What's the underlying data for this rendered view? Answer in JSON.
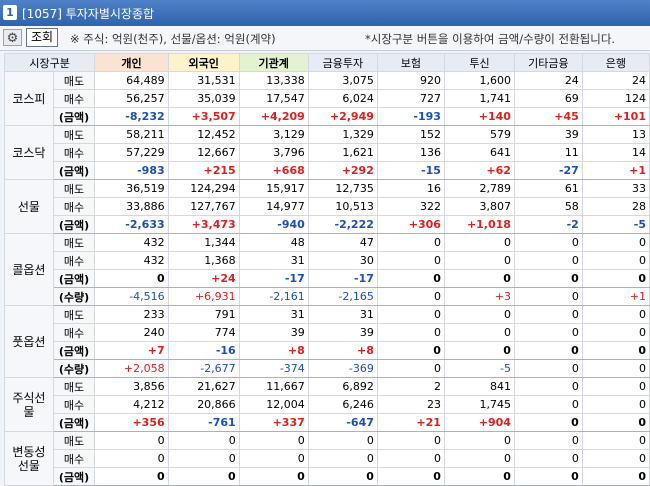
{
  "window": {
    "icon": "1",
    "title": "[1057] 투자자별시장종합"
  },
  "toolbar": {
    "settings_icon": "gear-icon",
    "query_label": "조회",
    "unit_note": "※ 주식: 억원(천주), 선물/옵션: 억원(계약)",
    "hint_note": "*시장구분 버튼을 이용하여 금액/수량이 전환됩니다."
  },
  "colors": {
    "positive": "#e02020",
    "negative": "#1b4fb8",
    "individual_header": "#fbe3d4",
    "foreign_header": "#fcf3cc",
    "institution_header": "#e3f2d3"
  },
  "table": {
    "headers": [
      "시장구분",
      "개인",
      "외국인",
      "기관계",
      "금융투자",
      "보험",
      "투신",
      "기타금융",
      "은행"
    ],
    "sections": [
      {
        "market": "코스피",
        "rows": [
          {
            "label": "매도",
            "type": "plain",
            "cells": [
              "64,489",
              "31,531",
              "13,338",
              "3,075",
              "920",
              "1,600",
              "24",
              "24"
            ]
          },
          {
            "label": "매수",
            "type": "plain",
            "cells": [
              "56,257",
              "35,039",
              "17,547",
              "6,024",
              "727",
              "1,741",
              "69",
              "124"
            ]
          },
          {
            "label": "(금액)",
            "type": "amt",
            "cells": [
              "-8,232",
              "+3,507",
              "+4,209",
              "+2,949",
              "-193",
              "+140",
              "+45",
              "+101"
            ]
          }
        ]
      },
      {
        "market": "코스닥",
        "rows": [
          {
            "label": "매도",
            "type": "plain",
            "cells": [
              "58,211",
              "12,452",
              "3,129",
              "1,329",
              "152",
              "579",
              "39",
              "13"
            ]
          },
          {
            "label": "매수",
            "type": "plain",
            "cells": [
              "57,229",
              "12,667",
              "3,796",
              "1,621",
              "136",
              "641",
              "11",
              "14"
            ]
          },
          {
            "label": "(금액)",
            "type": "amt",
            "cells": [
              "-983",
              "+215",
              "+668",
              "+292",
              "-15",
              "+62",
              "-27",
              "+1"
            ]
          }
        ]
      },
      {
        "market": "선물",
        "rows": [
          {
            "label": "매도",
            "type": "plain",
            "cells": [
              "36,519",
              "124,294",
              "15,917",
              "12,735",
              "16",
              "2,789",
              "61",
              "33"
            ]
          },
          {
            "label": "매수",
            "type": "plain",
            "cells": [
              "33,886",
              "127,767",
              "14,977",
              "10,513",
              "322",
              "3,807",
              "58",
              "28"
            ]
          },
          {
            "label": "(금액)",
            "type": "amt",
            "cells": [
              "-2,633",
              "+3,473",
              "-940",
              "-2,222",
              "+306",
              "+1,018",
              "-2",
              "-5"
            ]
          }
        ]
      },
      {
        "market": "콜옵션",
        "rows": [
          {
            "label": "매도",
            "type": "plain",
            "cells": [
              "432",
              "1,344",
              "48",
              "47",
              "0",
              "0",
              "0",
              "0"
            ]
          },
          {
            "label": "매수",
            "type": "plain",
            "cells": [
              "432",
              "1,368",
              "31",
              "30",
              "0",
              "0",
              "0",
              "0"
            ]
          },
          {
            "label": "(금액)",
            "type": "amt",
            "cells": [
              "0",
              "+24",
              "-17",
              "-17",
              "0",
              "0",
              "0",
              "0"
            ]
          },
          {
            "label": "(수량)",
            "type": "qty",
            "cells": [
              "-4,516",
              "+6,931",
              "-2,161",
              "-2,165",
              "0",
              "+3",
              "0",
              "+1"
            ]
          }
        ]
      },
      {
        "market": "풋옵션",
        "rows": [
          {
            "label": "매도",
            "type": "plain",
            "cells": [
              "233",
              "791",
              "31",
              "31",
              "0",
              "0",
              "0",
              "0"
            ]
          },
          {
            "label": "매수",
            "type": "plain",
            "cells": [
              "240",
              "774",
              "39",
              "39",
              "0",
              "0",
              "0",
              "0"
            ]
          },
          {
            "label": "(금액)",
            "type": "amt",
            "cells": [
              "+7",
              "-16",
              "+8",
              "+8",
              "0",
              "0",
              "0",
              "0"
            ]
          },
          {
            "label": "(수량)",
            "type": "qty",
            "cells": [
              "+2,058",
              "-2,677",
              "-374",
              "-369",
              "0",
              "-5",
              "0",
              "0"
            ]
          }
        ]
      },
      {
        "market": "주식선물",
        "rows": [
          {
            "label": "매도",
            "type": "plain",
            "cells": [
              "3,856",
              "21,627",
              "11,667",
              "6,892",
              "2",
              "841",
              "0",
              "0"
            ]
          },
          {
            "label": "매수",
            "type": "plain",
            "cells": [
              "4,212",
              "20,866",
              "12,004",
              "6,246",
              "23",
              "1,745",
              "0",
              "0"
            ]
          },
          {
            "label": "(금액)",
            "type": "amt",
            "cells": [
              "+356",
              "-761",
              "+337",
              "-647",
              "+21",
              "+904",
              "0",
              "0"
            ]
          }
        ]
      },
      {
        "market": "변동성\n선물",
        "rows": [
          {
            "label": "매도",
            "type": "plain",
            "cells": [
              "0",
              "0",
              "0",
              "0",
              "0",
              "0",
              "0",
              "0"
            ]
          },
          {
            "label": "매수",
            "type": "plain",
            "cells": [
              "0",
              "0",
              "0",
              "0",
              "0",
              "0",
              "0",
              "0"
            ]
          },
          {
            "label": "(금액)",
            "type": "amt",
            "cells": [
              "0",
              "0",
              "0",
              "0",
              "0",
              "0",
              "0",
              "0"
            ]
          }
        ]
      }
    ]
  }
}
